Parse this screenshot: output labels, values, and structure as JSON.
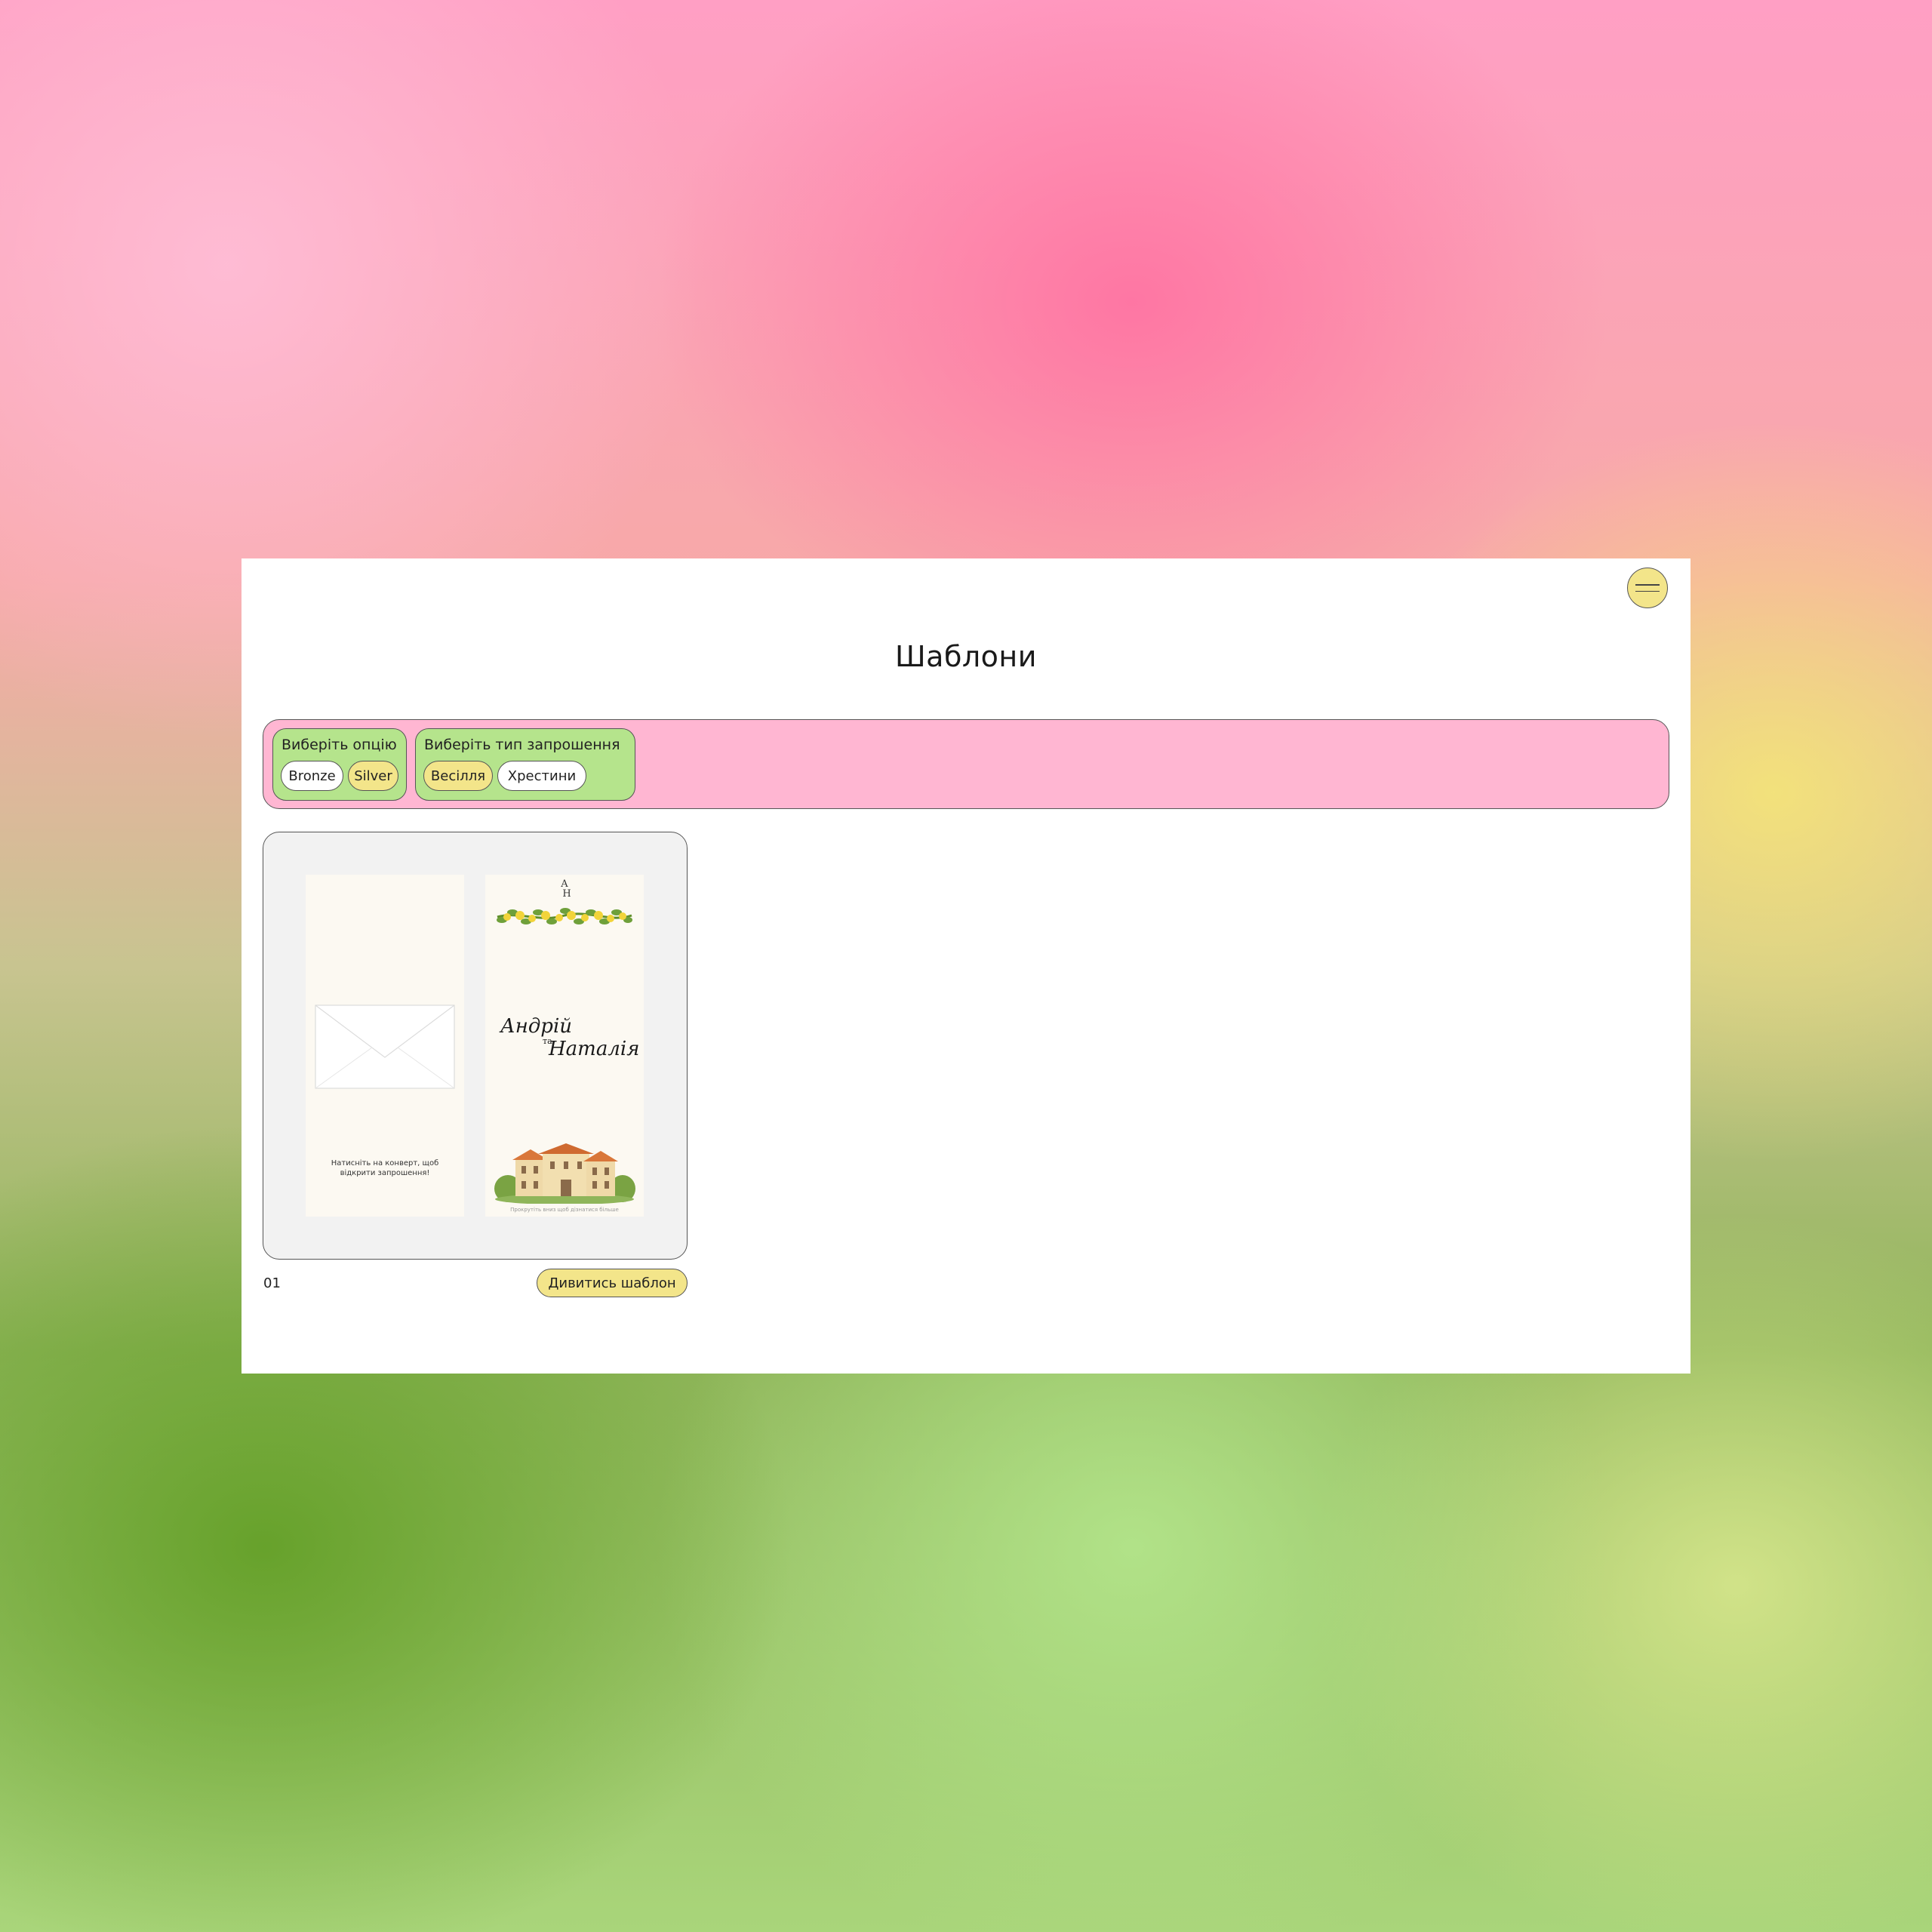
{
  "header": {
    "title": "Шаблони",
    "menu_icon": "hamburger-menu-icon"
  },
  "filters": {
    "option_group": {
      "label": "Виберіть опцію",
      "chips": [
        {
          "label": "Bronze",
          "selected": false
        },
        {
          "label": "Silver",
          "selected": true
        }
      ]
    },
    "type_group": {
      "label": "Виберіть тип запрошення",
      "chips": [
        {
          "label": "Весілля",
          "selected": true
        },
        {
          "label": "Хрестини",
          "selected": false
        }
      ]
    }
  },
  "templates": [
    {
      "number": "01",
      "view_label": "Дивитись шаблон",
      "preview": {
        "envelope_hint": "Натисніть на конверт, щоб відкрити запрошення!",
        "monogram_top": "A",
        "monogram_bottom": "H",
        "name_1": "Андрій",
        "name_joiner": "та",
        "name_2": "Наталія",
        "scroll_hint": "Прокрутіть вниз щоб дізнатися більше"
      }
    }
  ],
  "colors": {
    "accent_yellow": "#f3e58a",
    "filter_bar_pink": "#ffb6d2",
    "filter_group_green": "#b5e48c",
    "card_bg": "#f2f2f2"
  }
}
